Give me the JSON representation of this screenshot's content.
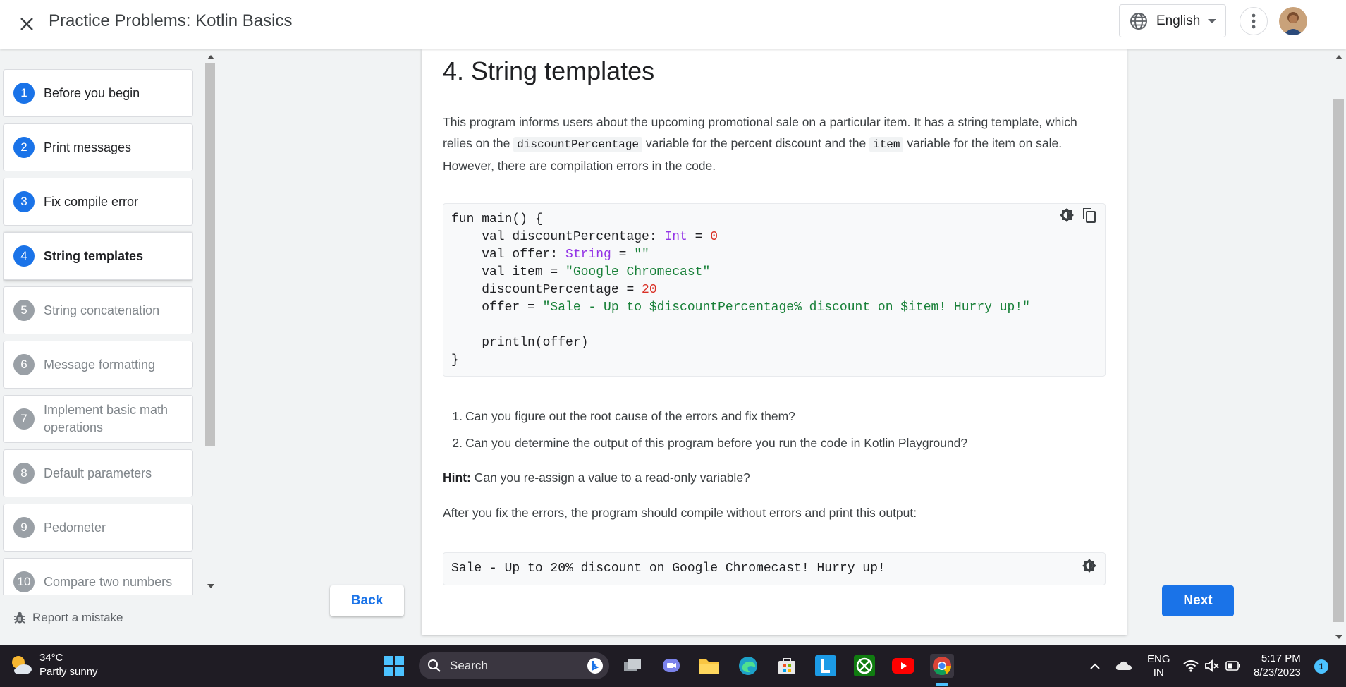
{
  "header": {
    "title": "Practice Problems: Kotlin Basics",
    "language": "English"
  },
  "sidebar": {
    "steps": [
      {
        "num": "1",
        "label": "Before you begin"
      },
      {
        "num": "2",
        "label": "Print messages"
      },
      {
        "num": "3",
        "label": "Fix compile error"
      },
      {
        "num": "4",
        "label": "String templates"
      },
      {
        "num": "5",
        "label": "String concatenation"
      },
      {
        "num": "6",
        "label": "Message formatting"
      },
      {
        "num": "7",
        "label": "Implement basic math operations"
      },
      {
        "num": "8",
        "label": "Default parameters"
      },
      {
        "num": "9",
        "label": "Pedometer"
      },
      {
        "num": "10",
        "label": "Compare two numbers"
      }
    ],
    "report": "Report a mistake"
  },
  "content": {
    "title": "4. String templates",
    "intro_a": "This program informs users about the upcoming promotional sale on a particular item. It has a string template, which relies on the ",
    "intro_code1": "discountPercentage",
    "intro_b": " variable for the percent discount and the ",
    "intro_code2": "item",
    "intro_c": " variable for the item on sale. However, there are compilation errors in the code.",
    "questions": [
      {
        "num": "1.",
        "text": "Can you figure out the root cause of the errors and fix them?"
      },
      {
        "num": "2.",
        "text": "Can you determine the output of this program before you run the code in Kotlin Playground?"
      }
    ],
    "hint_label": "Hint:",
    "hint_text": " Can you re-assign a value to a read-only variable?",
    "after_text": "After you fix the errors, the program should compile without errors and print this output:",
    "output": "Sale - Up to 20% discount on Google Chromecast! Hurry up!"
  },
  "code": {
    "l1": "fun main() {",
    "l2a": "    val discountPercentage: ",
    "l2type": "Int",
    "l2b": " = ",
    "l2num": "0",
    "l3a": "    val offer: ",
    "l3type": "String",
    "l3b": " = ",
    "l3str": "\"\"",
    "l4a": "    val item = ",
    "l4str": "\"Google Chromecast\"",
    "l5a": "    discountPercentage = ",
    "l5num": "20",
    "l6a": "    offer = ",
    "l6str": "\"Sale - Up to $discountPercentage% discount on $item! Hurry up!\"",
    "l8": "    println(offer)",
    "l9": "}"
  },
  "nav": {
    "back": "Back",
    "next": "Next"
  },
  "taskbar": {
    "temp": "34°C",
    "weather": "Partly sunny",
    "search": "Search",
    "lang1": "ENG",
    "lang2": "IN",
    "time": "5:17 PM",
    "date": "8/23/2023",
    "notifications": "1"
  }
}
